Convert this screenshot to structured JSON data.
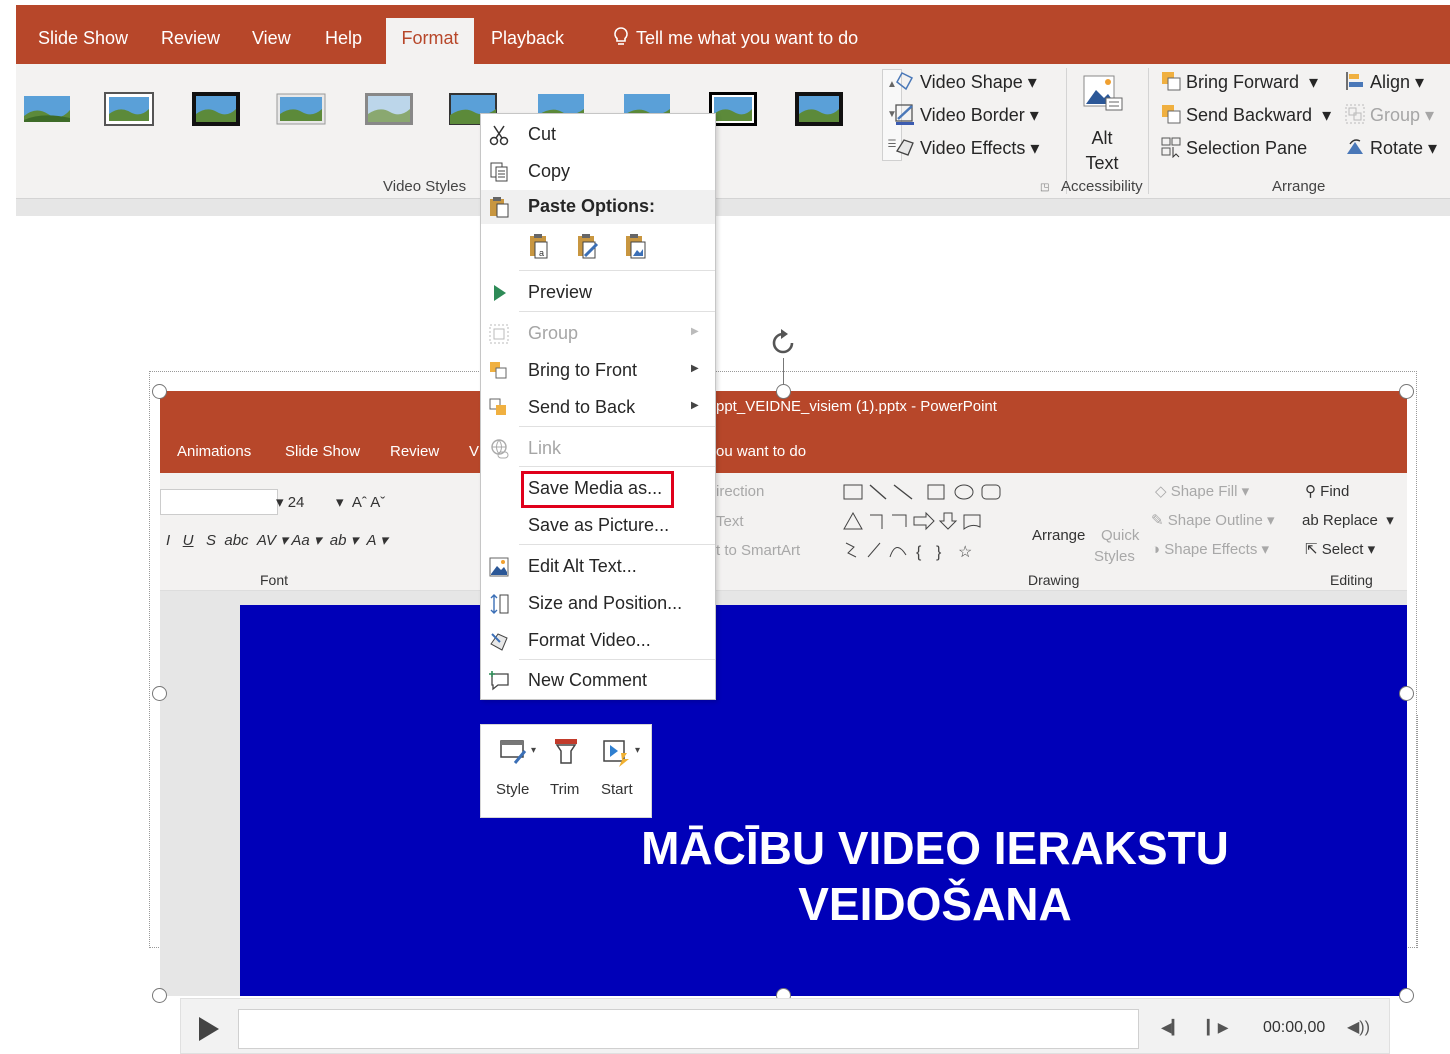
{
  "ribbon_tabs": {
    "slide_show": "Slide Show",
    "review": "Review",
    "view": "View",
    "help": "Help",
    "format": "Format",
    "playback": "Playback",
    "tell_me": "Tell me what you want to do"
  },
  "ribbon": {
    "video_styles_label": "Video Styles",
    "video_shape": "Video Shape",
    "video_border": "Video Border",
    "video_effects": "Video Effects",
    "alt_text_line1": "Alt",
    "alt_text_line2": "Text",
    "accessibility_label": "Accessibility",
    "bring_forward": "Bring Forward",
    "send_backward": "Send Backward",
    "selection_pane": "Selection Pane",
    "align": "Align",
    "group": "Group",
    "rotate": "Rotate",
    "arrange_label": "Arrange"
  },
  "context_menu": {
    "cut": "Cut",
    "copy": "Copy",
    "paste_options": "Paste Options:",
    "preview": "Preview",
    "group": "Group",
    "bring_to_front": "Bring to Front",
    "send_to_back": "Send to Back",
    "link": "Link",
    "save_media_as": "Save Media as...",
    "save_as_picture": "Save as Picture...",
    "edit_alt_text": "Edit Alt Text...",
    "size_and_position": "Size and Position...",
    "format_video": "Format Video...",
    "new_comment": "New Comment"
  },
  "mini_toolbar": {
    "style": "Style",
    "trim": "Trim",
    "start": "Start"
  },
  "embedded": {
    "doc_title": "ppt_VEIDNE_visiem (1).pptx  -  PowerPoint",
    "tabs": [
      "Animations",
      "Slide Show",
      "Review",
      "V",
      "ou want to do"
    ],
    "font_size": "24",
    "font_label": "Font",
    "direction": "irection",
    "text": "Text",
    "smartart": "t to SmartArt",
    "arrange": "Arrange",
    "quick": "Quick",
    "styles": "Styles",
    "shape_fill": "Shape Fill",
    "shape_outline": "Shape Outline",
    "shape_effects": "Shape Effects",
    "drawing_label": "Drawing",
    "find": "Find",
    "replace": "Replace",
    "select": "Select",
    "editing_label": "Editing"
  },
  "slide": {
    "title_line1": "MĀCĪBU VIDEO IERAKSTU",
    "title_line2": "VEIDOŠANA"
  },
  "player": {
    "time": "00:00,00"
  },
  "colors": {
    "accent": "#b7472a",
    "slide_bg": "#0000b8",
    "highlight": "#e0001b"
  }
}
